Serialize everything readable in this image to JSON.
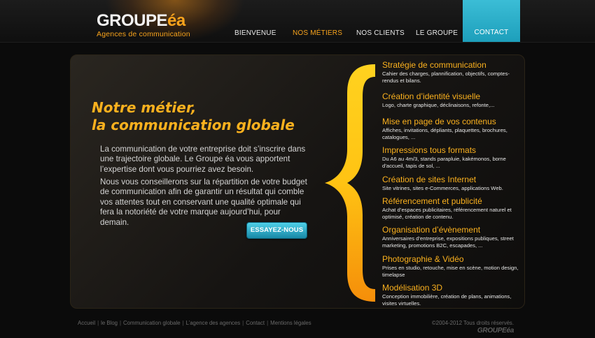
{
  "header": {
    "logo_main": "GROUPE",
    "logo_accent": "éa",
    "logo_tagline": "Agences de communication",
    "nav": [
      {
        "label": "BIENVENUE",
        "active": false
      },
      {
        "label": "NOS MÉTIERS",
        "active": true
      },
      {
        "label": "NOS CLIENTS",
        "active": false
      },
      {
        "label": "LE GROUPE",
        "active": false
      }
    ],
    "contact": "CONTACT"
  },
  "main": {
    "headline_line1": "Notre métier,",
    "headline_line2": "la communication globale",
    "paragraph1": "La communication de votre entreprise doit s’inscrire dans une trajectoire globale. Le Groupe éa vous apportent l’expertise dont vous pourriez avez besoin.",
    "paragraph2": "Nous vous conseillerons sur la répartition de votre budget de communication afin de garantir un résultat qui comble vos attentes tout en conservant une qualité optimale qui fera la notoriété de votre marque aujourd’hui, pour demain.",
    "cta": "ESSAYEZ-NOUS"
  },
  "services": [
    {
      "title": "Stratégie de communication",
      "desc": "Cahier des charges, plannification, objectifs, comptes-rendus et bilans."
    },
    {
      "title": "Création d’identité visuelle",
      "desc": "Logo, charte graphique, déclinaisons, refonte,..."
    },
    {
      "title": "Mise en page de vos contenus",
      "desc": "Affiches, invitations, dépliants, plaquettes, brochures, catalogues, ..."
    },
    {
      "title": "Impressions tous formats",
      "desc": "Du A6 au 4m/3, stands parapluie, kakémonos, borne d’accueil, tapis de sol, ..."
    },
    {
      "title": "Création de sites Internet",
      "desc": "Site vitrines, sites e-Commerces, applications Web."
    },
    {
      "title": "Référencement et publicité",
      "desc": "Achat d’espaces publicitaires, référencement naturel et optimisé, création de contenu."
    },
    {
      "title": "Organisation d’évènement",
      "desc": "Anniversaires d’entreprise, expositions publiques, street marketing, promotions B2C, escapades, ..."
    },
    {
      "title": "Photographie & Vidéo",
      "desc": "Prises en studio, retouche, mise en scène, motion design, timelapse"
    },
    {
      "title": "Modélisation 3D",
      "desc": "Conception immobilière, création de plans, animations, visites virtuelles."
    }
  ],
  "footer": {
    "links": [
      "Accueil",
      "le Blog",
      "Communication globale",
      "L’agence des agences",
      "Contact",
      "Mentions légales"
    ],
    "separator": "|",
    "copyright": "©2004-2012 Tous droits réservés.",
    "logo_main": "GROUPE",
    "logo_accent": "éa"
  },
  "colors": {
    "accent_orange": "#fbb11e",
    "accent_blue": "#1d9fbb",
    "background": "#0b0b0b"
  }
}
